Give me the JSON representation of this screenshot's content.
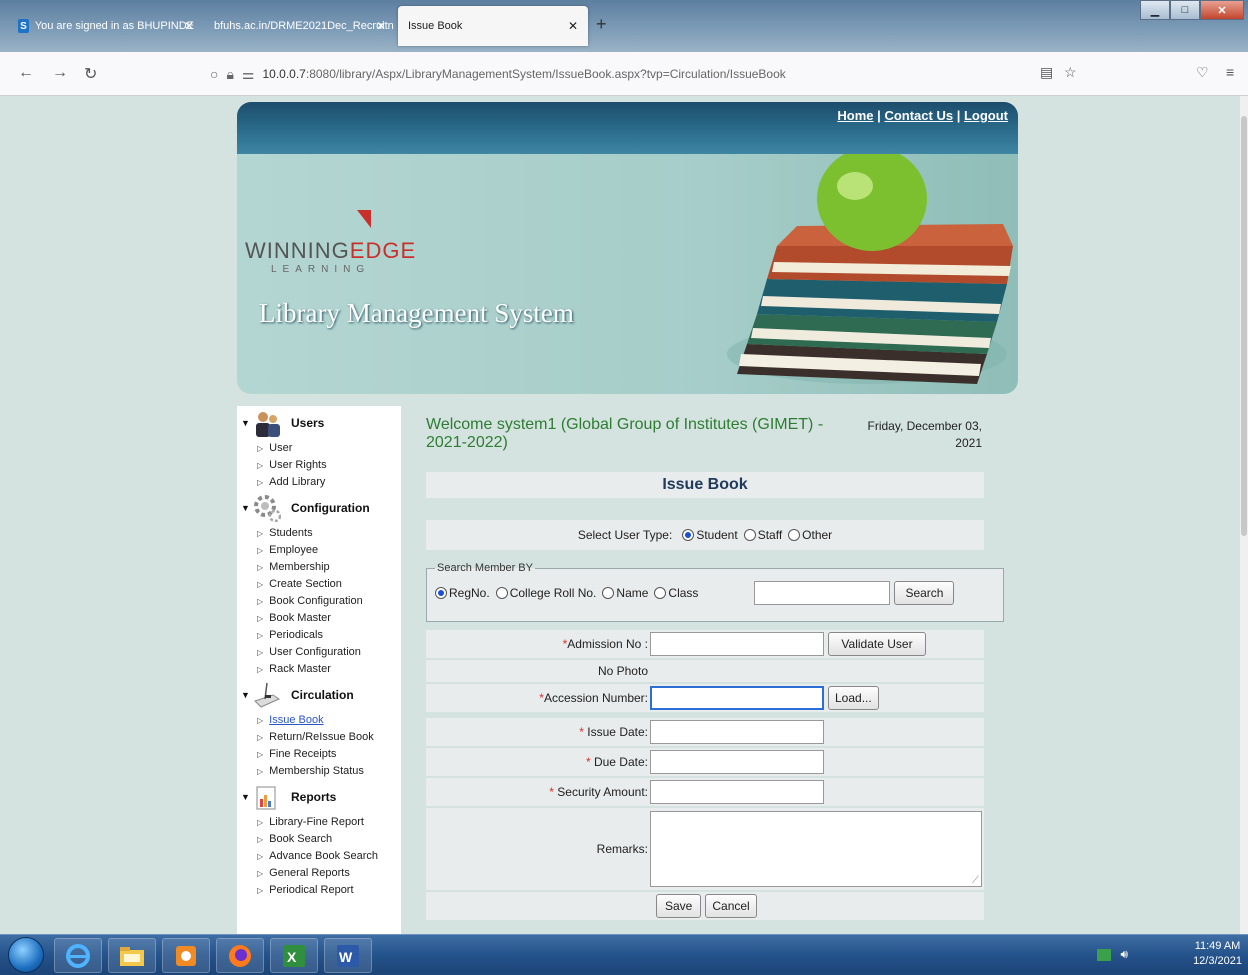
{
  "browser": {
    "tabs": [
      {
        "label": "You are signed in as BHUPINDE",
        "favicon": "S"
      },
      {
        "label": "bfuhs.ac.in/DRME2021Dec_Recruitn"
      },
      {
        "label": "Issue Book"
      }
    ],
    "new_tab": "+",
    "url_host": "10.0.0.7",
    "url_path": ":8080/library/Aspx/LibraryManagementSystem/IssueBook.aspx?tvp=Circulation/IssueBook"
  },
  "header": {
    "home": "Home",
    "contact": "Contact Us",
    "logout": "Logout",
    "sep": "|",
    "brand_main": "WINNING",
    "brand_edge": "EDGE",
    "brand_sub": "LEARNING",
    "system_title": "Library Management System"
  },
  "sidebar": {
    "sections": [
      {
        "title": "Users",
        "items": [
          "User",
          "User Rights",
          "Add Library"
        ]
      },
      {
        "title": "Configuration",
        "items": [
          "Students",
          "Employee",
          "Membership",
          "Create Section",
          "Book Configuration",
          "Book Master",
          "Periodicals",
          "User Configuration",
          "Rack Master"
        ]
      },
      {
        "title": "Circulation",
        "items": [
          "Issue Book",
          "Return/ReIssue Book",
          "Fine Receipts",
          "Membership Status"
        ]
      },
      {
        "title": "Reports",
        "items": [
          "Library-Fine Report",
          "Book Search",
          "Advance Book Search",
          "General Reports",
          "Periodical Report"
        ]
      }
    ]
  },
  "main": {
    "welcome": "Welcome system1 (Global Group of Institutes (GIMET) - 2021-2022)",
    "date_line1": "Friday, December 03,",
    "date_line2": "2021",
    "panel_title": "Issue Book",
    "user_type_label": "Select User Type:",
    "user_types": [
      "Student",
      "Staff",
      "Other"
    ],
    "search_legend": "Search Member BY",
    "search_options": [
      "RegNo.",
      "College Roll No.",
      "Name",
      "Class"
    ],
    "search_button": "Search",
    "fields": {
      "admission": "Admission No :",
      "validate_button": "Validate User",
      "no_photo": "No Photo",
      "accession": "Accession Number:",
      "load_button": "Load...",
      "issue_date": " Issue Date:",
      "due_date": " Due Date:",
      "security": " Security Amount:",
      "remarks": "Remarks:",
      "required_mark": "*"
    },
    "save_button": "Save",
    "cancel_button": "Cancel"
  },
  "taskbar": {
    "time": "11:49 AM",
    "date": "12/3/2021"
  }
}
